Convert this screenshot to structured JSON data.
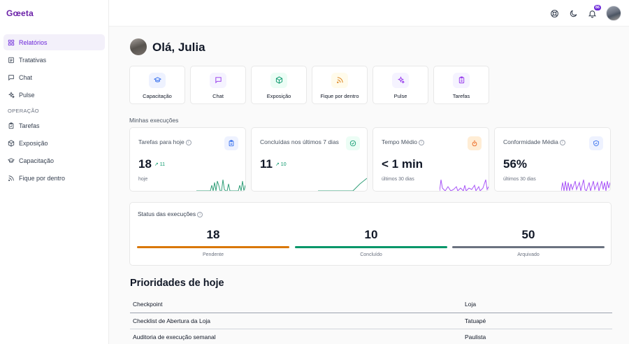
{
  "app": {
    "logo": "Gœeta"
  },
  "sidebar": {
    "items": [
      {
        "label": "Relatórios",
        "icon": "grid-icon",
        "active": true
      },
      {
        "label": "Tratativas",
        "icon": "clipboard-list-icon"
      },
      {
        "label": "Chat",
        "icon": "message-icon"
      },
      {
        "label": "Pulse",
        "icon": "sparkles-icon"
      }
    ],
    "section": "OPERAÇÃO",
    "ops_items": [
      {
        "label": "Tarefas",
        "icon": "clipboard-check-icon"
      },
      {
        "label": "Exposição",
        "icon": "box-icon"
      },
      {
        "label": "Capacitação",
        "icon": "graduation-cap-icon"
      },
      {
        "label": "Fique por dentro",
        "icon": "rss-icon"
      }
    ]
  },
  "topbar": {
    "icons": [
      "help-circle-icon",
      "moon-icon",
      "bell-icon"
    ],
    "notif_count": "86"
  },
  "greeting": "Olá, Julia",
  "shortcuts": [
    {
      "label": "Capacitação",
      "icon": "graduation-cap-icon",
      "color": "#2563eb",
      "bg": "#eef2ff"
    },
    {
      "label": "Chat",
      "icon": "message-icon",
      "color": "#9333ea",
      "bg": "#f5f3ff"
    },
    {
      "label": "Exposição",
      "icon": "box-icon",
      "color": "#059669",
      "bg": "#ecfdf5"
    },
    {
      "label": "Fique por dentro",
      "icon": "rss-icon",
      "color": "#d97706",
      "bg": "#fffbeb"
    },
    {
      "label": "Pulse",
      "icon": "sparkles-icon",
      "color": "#9333ea",
      "bg": "#f5f3ff"
    },
    {
      "label": "Tarefas",
      "icon": "clipboard-check-icon",
      "color": "#9333ea",
      "bg": "#f5f3ff"
    }
  ],
  "executions_label": "Minhas execuções",
  "kpis": [
    {
      "title": "Tarefas para hoje",
      "value": "18",
      "delta": "↗ 11",
      "sub": "hoje",
      "icon": "clipboard-icon",
      "icon_color": "#2563eb",
      "icon_bg": "#eef2ff",
      "spark_color": "#34a07a"
    },
    {
      "title": "Concluídas nos últimos 7 dias",
      "value": "11",
      "delta": "↗ 10",
      "sub": "",
      "icon": "check-circle-icon",
      "icon_color": "#059669",
      "icon_bg": "#ecfdf5",
      "spark_color": "#34a07a"
    },
    {
      "title": "Tempo Médio",
      "value": "< 1 min",
      "delta": "",
      "sub": "últimos 30 dias",
      "icon": "timer-icon",
      "icon_color": "#ea580c",
      "icon_bg": "#ffedd5",
      "spark_color": "#a855f7"
    },
    {
      "title": "Conformidade Média",
      "value": "56%",
      "delta": "",
      "sub": "últimos 30 dias",
      "icon": "shield-check-icon",
      "icon_color": "#2563eb",
      "icon_bg": "#eef2ff",
      "spark_color": "#a855f7"
    }
  ],
  "status": {
    "title": "Status das execuções",
    "items": [
      {
        "value": "18",
        "label": "Pendente",
        "color": "#d97706"
      },
      {
        "value": "10",
        "label": "Concluído",
        "color": "#059669"
      },
      {
        "value": "50",
        "label": "Arquivado",
        "color": "#6b7280"
      }
    ]
  },
  "priorities": {
    "title": "Prioridades de hoje",
    "columns": [
      "Checkpoint",
      "Loja"
    ],
    "rows": [
      [
        "Checklist de Abertura da Loja",
        "Tatuapé"
      ],
      [
        "Auditoria de execução semanal",
        "Paulista"
      ]
    ]
  }
}
